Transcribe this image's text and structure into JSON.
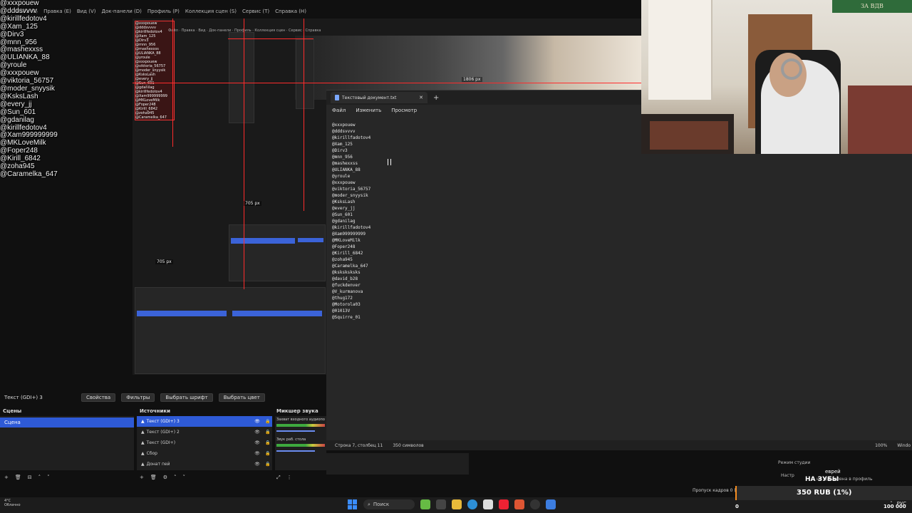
{
  "obs_menu": [
    "Файл (F)",
    "Правка (E)",
    "Вид (V)",
    "Док-панели (D)",
    "Профиль (P)",
    "Коллекция сцен (S)",
    "Сервис (T)",
    "Справка (H)"
  ],
  "chat_overlay": [
    "@xxxpouew",
    "@dddsvvvv",
    "@kirillfedotov4",
    "@Xam_125",
    "@Dirv3",
    "@mnn_956",
    "@mashexxss",
    "@ULIANKA_88",
    "@yroule",
    "@xxxpouew",
    "@viktoria_56757",
    "@moder_snyysik",
    "@KsksLash",
    "@every_jj",
    "@Sun_601",
    "@gdanilag",
    "@kirillfedotov4",
    "@Xam999999999",
    "@MKLoveMilk",
    "@Foper248",
    "@Kirill_6842",
    "@zoha945",
    "@Caramelka_647"
  ],
  "preview": {
    "label_width": "1806 px",
    "label_height": "705 px",
    "label_height_small": "705 px"
  },
  "notepad": {
    "tab_title": "Текстовый документ.txt",
    "menu": [
      "Файл",
      "Изменить",
      "Просмотр"
    ],
    "lines": [
      "@xxxpouew",
      "@dddsvvvv",
      "@kirillfadotov4",
      "@Xam_125",
      "@Dirv3",
      "@mnn_956",
      "@mashexxss",
      "@ULIANKA_88",
      "@yroule",
      "@xxxpouew",
      "@viktoria_56757",
      "@moder_snyysik",
      "@KsksLash",
      "@every_jj",
      "@Sun_601",
      "@gdanilag",
      "@kirillfadotov4",
      "@Xam999999999",
      "@MKLoveMilk",
      "@Foper248",
      "@Kirill_6842",
      "@zoha945",
      "@Caramelka_647",
      "@ksksksksks",
      "@david_b28",
      "@fuckdenver",
      "@V_kurmanova",
      "@thug172",
      "@Motorola03",
      "@01013V",
      "@Squirre_01"
    ],
    "status_pos": "Строка 7, столбец 11",
    "status_chars": "350 символов",
    "status_zoom": "100%",
    "status_os": "Windo"
  },
  "webcam": {
    "flag_text": "ЗА ВДВ"
  },
  "obs_toolbar": {
    "source_name": "Текст (GDI+) 3",
    "properties": "Свойства",
    "filters": "Фильтры",
    "select_font": "Выбрать шрифт",
    "select_color": "Выбрать цвет"
  },
  "docks": {
    "scenes_title": "Сцены",
    "sources_title": "Источники",
    "mixer_title": "Микшер звука",
    "scene": "Сцена",
    "sources": [
      {
        "label": "Текст (GDI+) 3",
        "active": true
      },
      {
        "label": "Текст (GDI+) 2",
        "active": false
      },
      {
        "label": "Текст (GDI+)",
        "active": false
      },
      {
        "label": "Сбор",
        "active": false
      },
      {
        "label": "Донат пей",
        "active": false
      }
    ],
    "mixer_line1": "Захват входного аудиопо",
    "mixer_line2": "Звук раб. стола"
  },
  "alert": {
    "studio": "Режим студии",
    "settings": "Настр",
    "donor": "еврей",
    "message": "НА ЗУБЫ",
    "hint": "не добавлена в профиль"
  },
  "goal": {
    "label": "Пропуск кадров 0 (0",
    "text": "350 RUB (1%)",
    "min": "0",
    "max": "100 000",
    "progress": 0.01
  },
  "taskbar": {
    "weather": "4°C\nОблачно",
    "search": "Поиск",
    "lang": "РУС"
  }
}
